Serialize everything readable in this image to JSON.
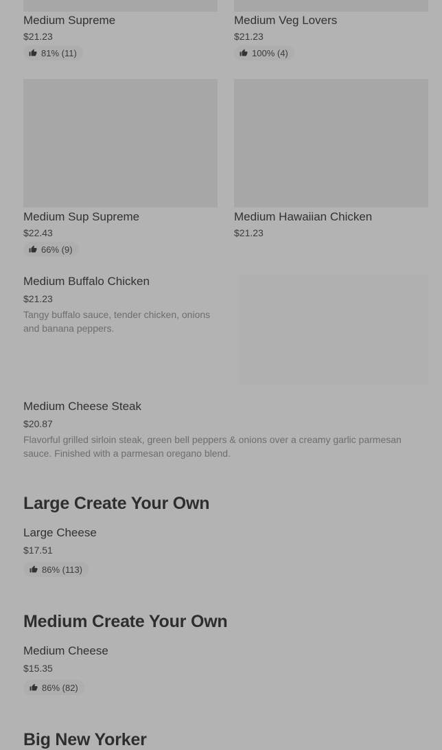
{
  "items": [
    {
      "name": "Medium Supreme",
      "price": "$21.23",
      "rating": "81% (11)"
    },
    {
      "name": "Medium Veg Lovers",
      "price": "$21.23",
      "rating": "100% (4)"
    },
    {
      "name": "Medium Sup Supreme",
      "price": "$22.43",
      "rating": "66% (9)"
    },
    {
      "name": "Medium Hawaiian Chicken",
      "price": "$21.23"
    },
    {
      "name": "Medium Buffalo Chicken",
      "price": "$21.23",
      "description": "Tangy buffalo sauce, tender chicken, onions and banana peppers."
    },
    {
      "name": "Medium Cheese Steak",
      "price": "$20.87",
      "description": "Flavorful grilled sirloin steak, green bell peppers & onions over a creamy garlic parmesan sauce. Finished with a parmesan oregano blend."
    }
  ],
  "sections": [
    {
      "title": "Large Create Your Own",
      "items": [
        {
          "name": "Large Cheese",
          "price": "$17.51",
          "rating": "86% (113)"
        }
      ]
    },
    {
      "title": "Medium Create Your Own",
      "items": [
        {
          "name": "Medium Cheese",
          "price": "$15.35",
          "rating": "86% (82)"
        }
      ]
    },
    {
      "title": "Big New Yorker"
    }
  ],
  "icons": {
    "rating": "thumbs-up-icon"
  },
  "colors": {
    "background": "#b3b3b3",
    "image_placeholder": "#a7a7a7",
    "badge": "#aeaeae"
  }
}
